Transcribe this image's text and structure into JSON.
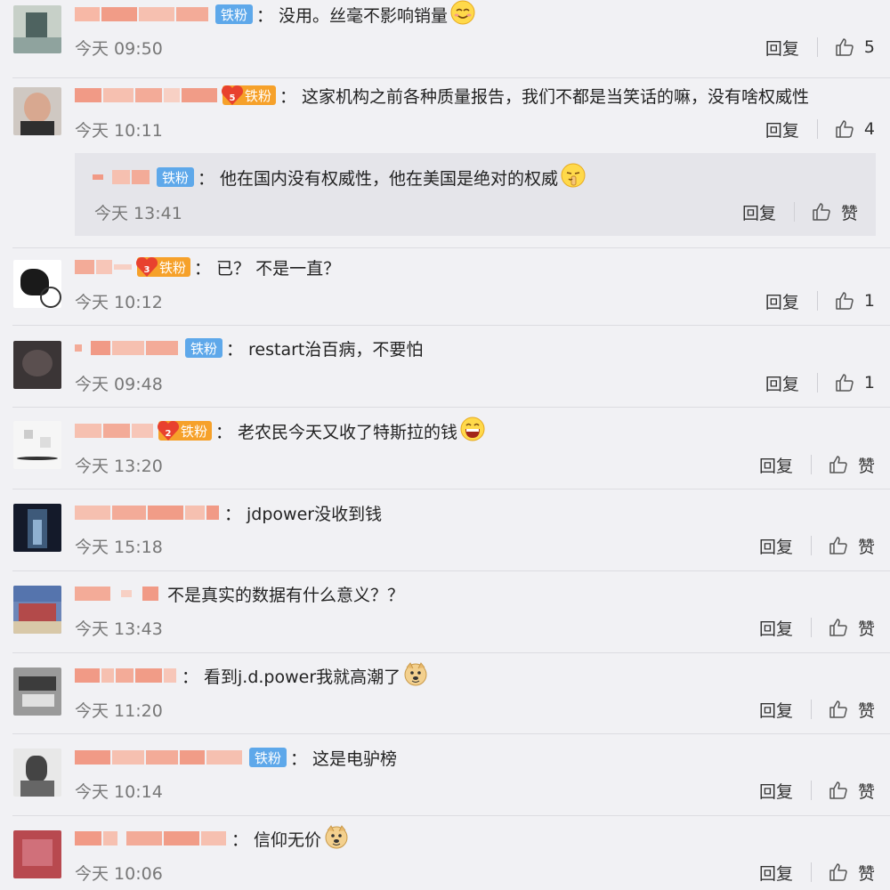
{
  "labels": {
    "reply": "回复",
    "like_default": "赞"
  },
  "comments": [
    {
      "badge": "铁粉",
      "text": "没用。丝毫不影响销量",
      "time": "今天 09:50",
      "likes": "5",
      "emoji": "smile"
    },
    {
      "badge": "铁粉",
      "badge_level": "5",
      "text": "这家机构之前各种质量报告，我们不都是当笑话的嘛，没有啥权威性",
      "time": "今天 10:11",
      "likes": "4",
      "reply": {
        "badge": "铁粉",
        "text": "他在国内没有权威性，他在美国是绝对的权威",
        "time": "今天 13:41",
        "likes": "赞",
        "emoji": "shush"
      }
    },
    {
      "badge": "铁粉",
      "badge_level": "3",
      "text": "已？ 不是一直？",
      "time": "今天 10:12",
      "likes": "1"
    },
    {
      "badge": "铁粉",
      "text": "restart治百病，不要怕",
      "time": "今天 09:48",
      "likes": "1"
    },
    {
      "badge": "铁粉",
      "badge_level": "2",
      "text": "老农民今天又收了特斯拉的钱",
      "time": "今天 13:20",
      "likes": "赞",
      "emoji": "laugh"
    },
    {
      "text": "jdpower没收到钱",
      "time": "今天 15:18",
      "likes": "赞"
    },
    {
      "text": "不是真实的数据有什么意义？？",
      "time": "今天 13:43",
      "likes": "赞"
    },
    {
      "text": "看到j.d.power我就高潮了",
      "time": "今天 11:20",
      "likes": "赞",
      "emoji": "doge"
    },
    {
      "badge": "铁粉",
      "text": "这是电驴榜",
      "time": "今天 10:14",
      "likes": "赞"
    },
    {
      "text": "信仰无价",
      "time": "今天 10:06",
      "likes": "赞",
      "emoji": "doge"
    }
  ],
  "colors": {
    "badge_blue": "#5ea8ea",
    "badge_orange": "#f6a12a",
    "name_blurred": "#f3a58f",
    "background": "#f1f1f4"
  },
  "icons": {
    "like": "thumbs-up-icon"
  }
}
